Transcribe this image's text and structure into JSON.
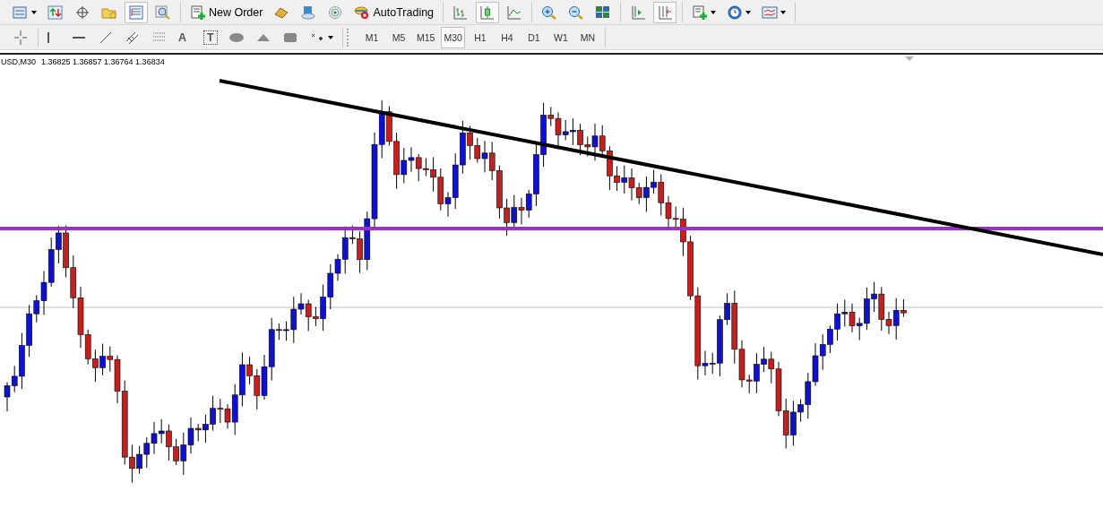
{
  "main_toolbar": [
    [
      {
        "kind": "icon",
        "selected": false
      },
      {
        "kind": "icon",
        "selected": false
      },
      {
        "kind": "icon",
        "selected": false
      },
      {
        "kind": "icon",
        "selected": false
      },
      {
        "kind": "icon",
        "selected": true
      },
      {
        "kind": "icon",
        "selected": false
      }
    ],
    [
      {
        "kind": "labeled",
        "label": "New Order",
        "selected": false
      },
      {
        "kind": "icon",
        "selected": false
      },
      {
        "kind": "icon",
        "selected": false
      },
      {
        "kind": "icon",
        "selected": false
      },
      {
        "kind": "labeled",
        "label": "AutoTrading",
        "selected": false
      }
    ],
    [
      {
        "kind": "icon",
        "selected": false
      },
      {
        "kind": "icon",
        "selected": true
      },
      {
        "kind": "icon",
        "selected": false
      }
    ],
    [
      {
        "kind": "icon",
        "selected": false
      },
      {
        "kind": "icon",
        "selected": false
      },
      {
        "kind": "icon",
        "selected": false
      }
    ],
    [
      {
        "kind": "icon",
        "selected": false
      },
      {
        "kind": "icon",
        "selected": true
      }
    ],
    [
      {
        "kind": "icon",
        "selected": false
      },
      {
        "kind": "icon",
        "selected": false
      },
      {
        "kind": "icon",
        "selected": false
      }
    ]
  ],
  "drawing_toolbar": [
    [
      {
        "kind": "icon"
      }
    ],
    [
      {
        "kind": "icon"
      },
      {
        "kind": "icon"
      },
      {
        "kind": "icon"
      },
      {
        "kind": "icon"
      },
      {
        "kind": "icon"
      },
      {
        "kind": "glyph",
        "label": "A"
      },
      {
        "kind": "boxed_glyph",
        "label": "T"
      },
      {
        "kind": "icon"
      },
      {
        "kind": "icon"
      },
      {
        "kind": "icon"
      },
      {
        "kind": "icon"
      }
    ]
  ],
  "timeframes": [
    {
      "label": "M1",
      "selected": false
    },
    {
      "label": "M5",
      "selected": false
    },
    {
      "label": "M15",
      "selected": false
    },
    {
      "label": "M30",
      "selected": true
    },
    {
      "label": "H1",
      "selected": false
    },
    {
      "label": "H4",
      "selected": false
    },
    {
      "label": "D1",
      "selected": false
    },
    {
      "label": "W1",
      "selected": false
    },
    {
      "label": "MN",
      "selected": false
    }
  ],
  "chart": {
    "symbol": "USD,M30",
    "quotes": "1.36825 1.36857 1.36764 1.36834"
  }
}
